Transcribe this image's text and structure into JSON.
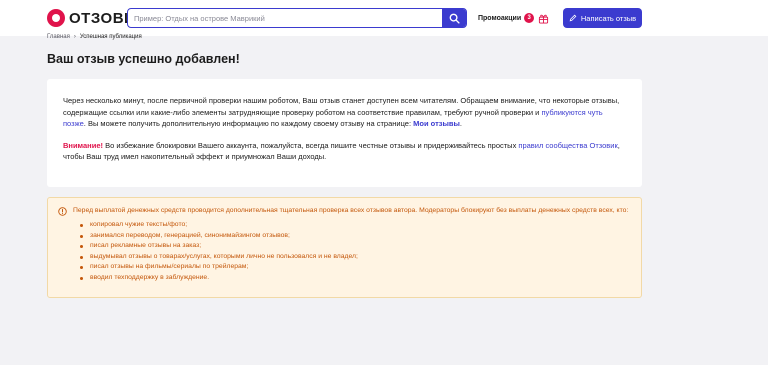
{
  "header": {
    "logo_text": "ОТЗОВИК",
    "search_placeholder": "Пример: Отдых на острове Маврикий",
    "promo_label": "Промоакции",
    "promo_count": "3",
    "write_review_label": "Написать отзыв"
  },
  "breadcrumb": {
    "home": "Главная",
    "separator": "›",
    "current": "Успешная публикация"
  },
  "page_title": "Ваш отзыв успешно добавлен!",
  "card": {
    "p1_text": "Через несколько минут, после первичной проверки нашим роботом, Ваш отзыв станет доступен всем читателям. Обращаем внимание, что некоторые отзывы, содержащие ссылки или какие-либо элементы затрудняющие проверку роботом на соответствие правилам, требуют ручной проверки и ",
    "p1_link": "публикуются чуть позже",
    "p1_text2": ". Вы можете получить дополнительную информацию по каждому своему отзыву на странице: ",
    "my_reviews_link": "Мои отзывы",
    "p1_end": ".",
    "warn_label": "Внимание!",
    "p2_text": " Во избежание блокировки Вашего аккаунта, пожалуйста, всегда пишите честные отзывы и придерживайтесь простых ",
    "rules_link": "правил сообщества Отзовик",
    "p2_end": ", чтобы Ваш труд имел накопительный эффект и приумножал Ваши доходы."
  },
  "notice": {
    "intro": "Перед выплатой денежных средств проводится дополнительная тщательная проверка всех отзывов автора. Модераторы блокируют без выплаты денежных средств всех, кто:",
    "items": [
      "копировал чужие тексты/фото;",
      "занимался переводом, генерацией, синонимайзингом отзывов;",
      "писал рекламные отзывы на заказ;",
      "выдумывал отзывы о товарах/услугах, которыми лично не пользовался и не владел;",
      "писал отзывы на фильмы/сериалы по трейлерам;",
      "вводил техподдержку в заблуждение."
    ]
  },
  "colors": {
    "brand_red": "#e0134b",
    "accent_blue": "#3b3bcf",
    "notice_text": "#c4570a",
    "notice_bg": "#fff4e3"
  },
  "icons": [
    "logo-mark-icon",
    "search-icon",
    "gift-icon",
    "pencil-icon",
    "warning-circle-icon"
  ]
}
